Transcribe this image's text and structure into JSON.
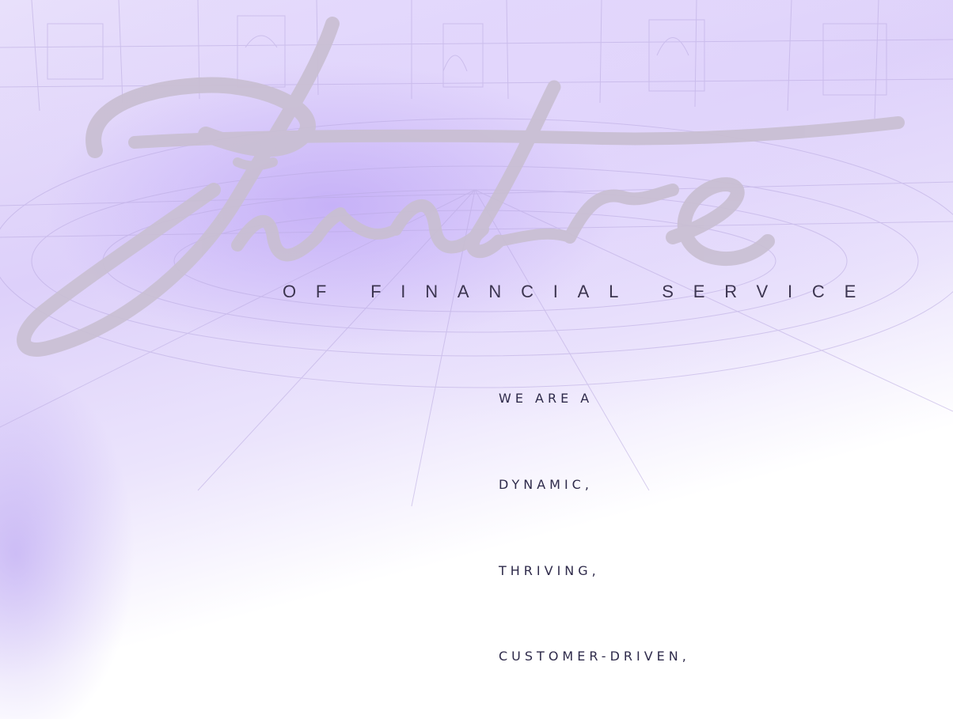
{
  "hero": {
    "script_word": "Future",
    "subtitle": "OF FINANCIAL SERVICE"
  },
  "taglines": [
    "WE ARE A",
    "DYNAMIC,",
    "THRIVING,",
    "CUSTOMER-DRIVEN,"
  ],
  "colors": {
    "accent_lavender": "#b296f5",
    "script_gray": "#c9c1d4",
    "text_dark": "#2e2a4a"
  }
}
